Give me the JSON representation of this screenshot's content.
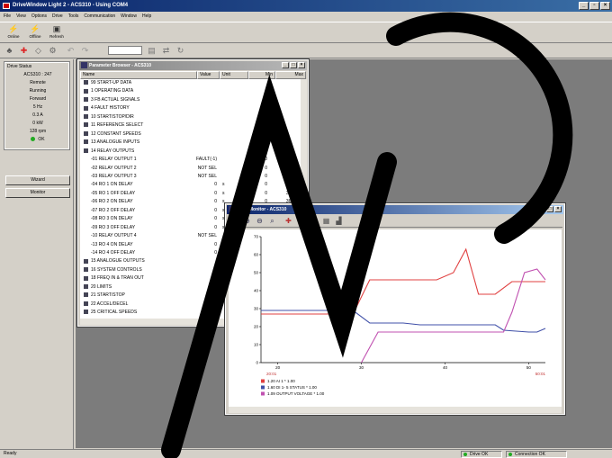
{
  "app": {
    "title": "DriveWindow Light 2 - ACS310 - Using COM4",
    "menu": [
      "File",
      "View",
      "Options",
      "Drive",
      "Tools",
      "Communication",
      "Window",
      "Help"
    ],
    "toolbar": {
      "online": "Online",
      "offline": "Offline",
      "refresh": "Refresh"
    },
    "status": {
      "ready": "Ready",
      "drive_ok": "Drive OK",
      "connection_ok": "Connection OK"
    }
  },
  "drive_status": {
    "caption": "Drive Status",
    "lines": [
      "ACS310 : 247",
      "Remote",
      "Running",
      "Forward",
      "5 Hz",
      "0.3 A",
      "0 kW",
      "128 rpm"
    ],
    "ok_label": "OK",
    "buttons": {
      "wizard": "Wizard",
      "monitor": "Monitor"
    }
  },
  "param_browser": {
    "title": "Parameter Browser - ACS310",
    "columns": [
      "Name",
      "Value",
      "Unit",
      "Min",
      "Max"
    ],
    "rows": [
      {
        "name": "99 START-UP DATA"
      },
      {
        "name": "1 OPERATING DATA"
      },
      {
        "name": "3 FB ACTUAL SIGNALS"
      },
      {
        "name": "4 FAULT HISTORY"
      },
      {
        "name": "10 START/STOP/DIR"
      },
      {
        "name": "11 REFERENCE SELECT"
      },
      {
        "name": "12 CONSTANT SPEEDS"
      },
      {
        "name": "13 ANALOGUE INPUTS"
      },
      {
        "name": "14 RELAY OUTPUTS"
      },
      {
        "name": "-01 RELAY OUTPUT 1",
        "value": "FAULT(-1)",
        "unit": "",
        "min": "0",
        "max": "56"
      },
      {
        "name": "-02 RELAY OUTPUT 2",
        "value": "NOT SEL",
        "unit": "",
        "min": "0",
        "max": "56"
      },
      {
        "name": "-03 RELAY OUTPUT 3",
        "value": "NOT SEL",
        "unit": "",
        "min": "0",
        "max": "56"
      },
      {
        "name": "-04 RO 1 ON DELAY",
        "value": "0",
        "unit": "s",
        "min": "0",
        "max": "3600"
      },
      {
        "name": "-05 RO 1 OFF DELAY",
        "value": "0",
        "unit": "s",
        "min": "0",
        "max": "3600"
      },
      {
        "name": "-06 RO 2 ON DELAY",
        "value": "0",
        "unit": "s",
        "min": "0",
        "max": "3600"
      },
      {
        "name": "-07 RO 2 OFF DELAY",
        "value": "0",
        "unit": "s",
        "min": "0",
        "max": ""
      },
      {
        "name": "-08 RO 3 ON DELAY",
        "value": "0",
        "unit": "s",
        "min": "",
        "max": ""
      },
      {
        "name": "-09 RO 3 OFF DELAY",
        "value": "0",
        "unit": "s",
        "min": "",
        "max": ""
      },
      {
        "name": "-10 RELAY OUTPUT 4",
        "value": "NOT SEL",
        "unit": "",
        "min": "",
        "max": ""
      },
      {
        "name": "-13 RO 4 ON DELAY",
        "value": "0",
        "unit": "",
        "min": "",
        "max": ""
      },
      {
        "name": "-14 RO 4 OFF DELAY",
        "value": "0",
        "unit": "",
        "min": "",
        "max": ""
      },
      {
        "name": "15 ANALOGUE OUTPUTS"
      },
      {
        "name": "16 SYSTEM CONTROLS"
      },
      {
        "name": "18 FREQ IN & TRAN OUT"
      },
      {
        "name": "20 LIMITS"
      },
      {
        "name": "21 START/STOP"
      },
      {
        "name": "22 ACCEL/DECEL"
      },
      {
        "name": "25 CRITICAL SPEEDS"
      }
    ]
  },
  "drive_monitor": {
    "title": "Drive Monitor - ACS310",
    "chart_data": {
      "type": "line",
      "x_ticks": [
        20,
        30,
        40,
        50
      ],
      "xlim": [
        18,
        52
      ],
      "ylim": [
        0,
        70
      ],
      "y_ticks": [
        0,
        10,
        20,
        30,
        40,
        50,
        60,
        70
      ],
      "x_start_label": "20:01",
      "x_end_label": "50:01",
      "grid": false,
      "legend_position": "bottom-left",
      "series": [
        {
          "name": "1.20 AI 1 * 1.00",
          "color": "#e04040",
          "x": [
            18,
            29,
            31,
            39,
            41,
            42.5,
            44,
            46,
            48,
            51,
            52
          ],
          "y": [
            27,
            27,
            46,
            46,
            50,
            63,
            38,
            38,
            45,
            45,
            45
          ]
        },
        {
          "name": "1.60 DI 1- 5 STATUS * 1.00",
          "color": "#4050a8",
          "x": [
            18,
            29,
            31,
            35,
            37,
            46,
            47,
            50,
            51,
            52
          ],
          "y": [
            29,
            29,
            22,
            22,
            21,
            21,
            18,
            17,
            17,
            19
          ]
        },
        {
          "name": "1.09 OUTPUT VOLTAGE * 1.00",
          "color": "#c050b0",
          "x": [
            30,
            32,
            47,
            48,
            49.5,
            51,
            52
          ],
          "y": [
            0,
            17,
            17,
            28,
            50,
            52,
            46
          ]
        }
      ]
    }
  },
  "colors": {
    "title_active": "#0a246a",
    "face": "#d4d0c8",
    "mdi_bg": "#7c7c7c",
    "ok_green": "#22aa22"
  }
}
